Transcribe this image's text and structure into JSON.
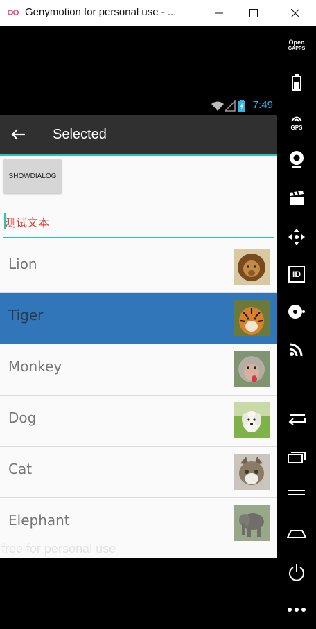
{
  "window": {
    "title": "Genymotion for personal use - ..."
  },
  "status": {
    "time": "7:49"
  },
  "toolbar": {
    "title": "Selected"
  },
  "dialog_button": {
    "label": "SHOWDIALOG"
  },
  "edit_text": {
    "value": "测试文本"
  },
  "list": {
    "items": [
      {
        "label": "Lion",
        "icon": "lion-photo"
      },
      {
        "label": "Tiger",
        "icon": "tiger-photo",
        "selected": true
      },
      {
        "label": "Monkey",
        "icon": "monkey-photo"
      },
      {
        "label": "Dog",
        "icon": "dog-photo"
      },
      {
        "label": "Cat",
        "icon": "cat-photo"
      },
      {
        "label": "Elephant",
        "icon": "elephant-photo"
      }
    ]
  },
  "watermark": {
    "text": "free for personal use"
  },
  "sidebar": {
    "open_gapps_line1": "Open",
    "open_gapps_line2": "GAPPS",
    "gps_label": "GPS",
    "id_label": "ID"
  },
  "colors": {
    "accent": "#26c6b4",
    "selected_row": "#3176b8",
    "toolbar": "#303030",
    "edit_text": "#e53935"
  }
}
